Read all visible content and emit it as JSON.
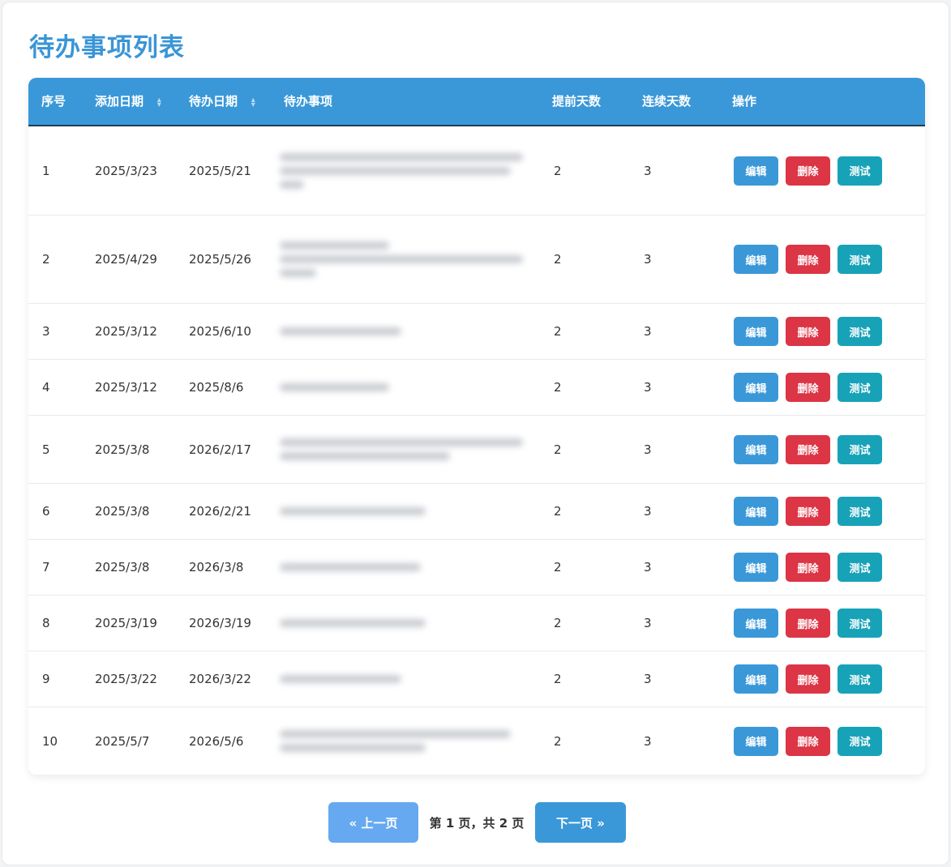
{
  "page_title": "待办事项列表",
  "columns": {
    "index": "序号",
    "added_date": "添加日期",
    "due_date": "待办日期",
    "item": "待办事项",
    "advance_days": "提前天数",
    "continuous_days": "连续天数",
    "actions": "操作"
  },
  "buttons": {
    "edit": "编辑",
    "delete": "删除",
    "test": "测试"
  },
  "rows": [
    {
      "index": "1",
      "added_date": "2025/3/23",
      "due_date": "2025/5/21",
      "advance_days": "2",
      "continuous_days": "3"
    },
    {
      "index": "2",
      "added_date": "2025/4/29",
      "due_date": "2025/5/26",
      "advance_days": "2",
      "continuous_days": "3"
    },
    {
      "index": "3",
      "added_date": "2025/3/12",
      "due_date": "2025/6/10",
      "advance_days": "2",
      "continuous_days": "3"
    },
    {
      "index": "4",
      "added_date": "2025/3/12",
      "due_date": "2025/8/6",
      "advance_days": "2",
      "continuous_days": "3"
    },
    {
      "index": "5",
      "added_date": "2025/3/8",
      "due_date": "2026/2/17",
      "advance_days": "2",
      "continuous_days": "3"
    },
    {
      "index": "6",
      "added_date": "2025/3/8",
      "due_date": "2026/2/21",
      "advance_days": "2",
      "continuous_days": "3"
    },
    {
      "index": "7",
      "added_date": "2025/3/8",
      "due_date": "2026/3/8",
      "advance_days": "2",
      "continuous_days": "3"
    },
    {
      "index": "8",
      "added_date": "2025/3/19",
      "due_date": "2026/3/19",
      "advance_days": "2",
      "continuous_days": "3"
    },
    {
      "index": "9",
      "added_date": "2025/3/22",
      "due_date": "2026/3/22",
      "advance_days": "2",
      "continuous_days": "3"
    },
    {
      "index": "10",
      "added_date": "2025/5/7",
      "due_date": "2026/5/6",
      "advance_days": "2",
      "continuous_days": "3"
    }
  ],
  "pagination": {
    "prev_label": "« 上一页",
    "info": "第 1 页，共 2 页",
    "next_label": "下一页 »"
  }
}
